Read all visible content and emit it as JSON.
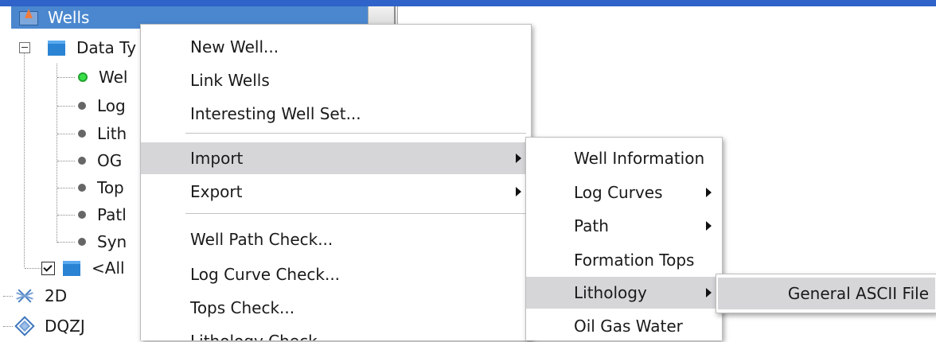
{
  "tree": {
    "wells_label": "Wells",
    "data_types_label": "Data Ty",
    "children": [
      "Wel",
      "Log",
      "Lith",
      "OG",
      "Top",
      "Patl",
      "Syn"
    ],
    "all_label": "<All",
    "item_2d": "2D",
    "item_dqzj": "DQZJ"
  },
  "context_menu": {
    "items": [
      "New Well...",
      "Link Wells",
      "Interesting Well Set...",
      "Import",
      "Export",
      "Well Path Check...",
      "Log Curve Check...",
      "Tops Check...",
      "Lithology Check..."
    ]
  },
  "import_submenu": {
    "items": [
      "Well Information",
      "Log Curves",
      "Path",
      "Formation Tops",
      "Lithology",
      "Oil Gas Water"
    ]
  },
  "lithology_submenu": {
    "items": [
      "General ASCII File"
    ]
  },
  "colors": {
    "selection_blue": "#4a87cf",
    "menu_highlight": "#d6d6d9",
    "top_bar": "#2f63c9",
    "status_green": "#3ae04a"
  },
  "icons": {
    "wells": "wells-icon",
    "folder": "folder-icon",
    "status_dot": "dot-icon",
    "submenu_arrow": "arrow-right-icon",
    "survey_2d": "2d-survey-icon",
    "dqzj": "dqzj-icon"
  }
}
